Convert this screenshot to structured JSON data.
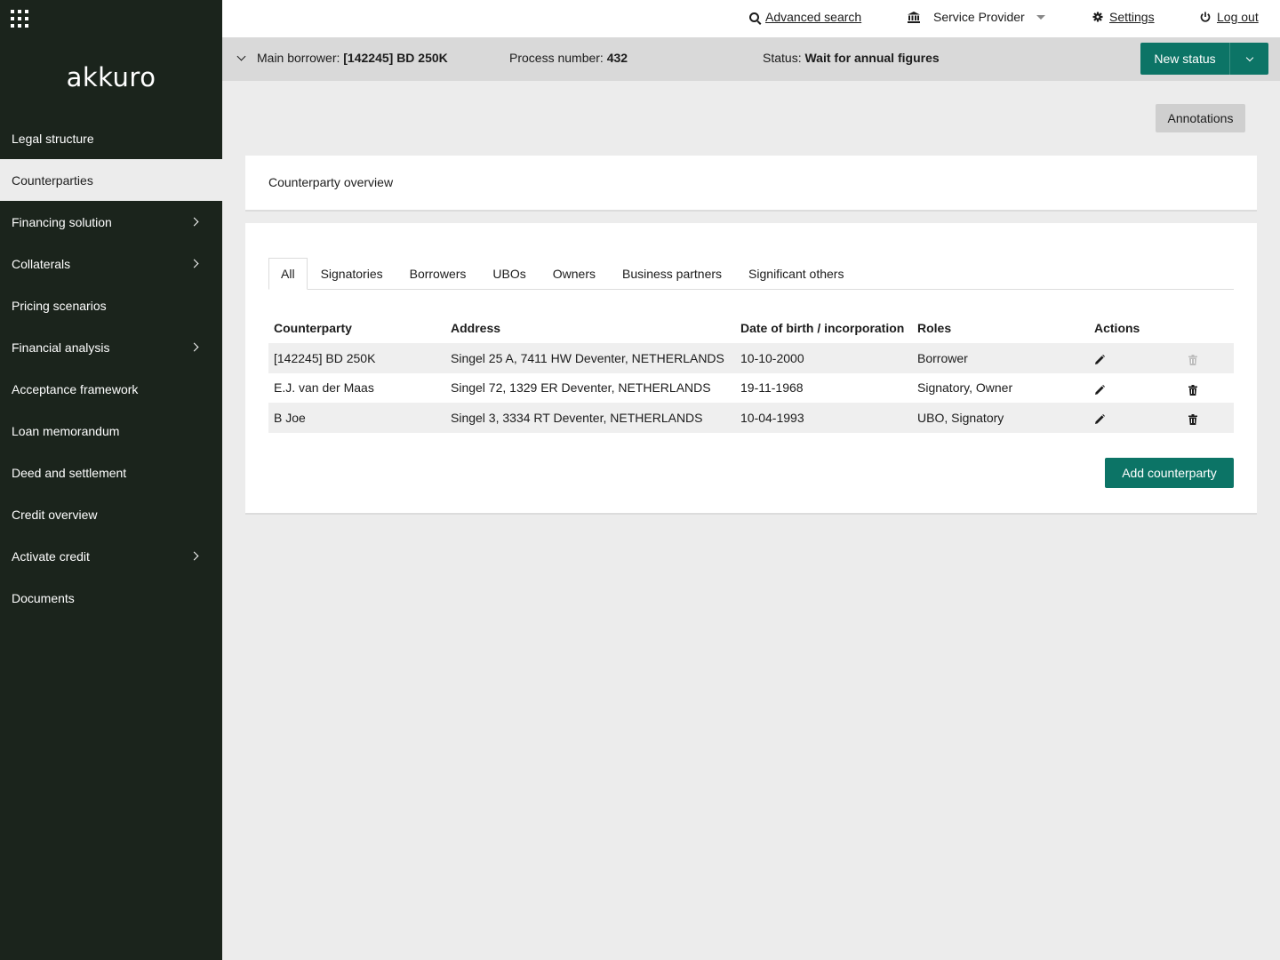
{
  "sidebar": {
    "logo": "akkuro",
    "items": [
      {
        "label": "Legal structure",
        "expandable": false,
        "active": false
      },
      {
        "label": "Counterparties",
        "expandable": false,
        "active": true
      },
      {
        "label": "Financing solution",
        "expandable": true,
        "active": false
      },
      {
        "label": "Collaterals",
        "expandable": true,
        "active": false
      },
      {
        "label": "Pricing scenarios",
        "expandable": false,
        "active": false
      },
      {
        "label": "Financial analysis",
        "expandable": true,
        "active": false
      },
      {
        "label": "Acceptance framework",
        "expandable": false,
        "active": false
      },
      {
        "label": "Loan memorandum",
        "expandable": false,
        "active": false
      },
      {
        "label": "Deed and settlement",
        "expandable": false,
        "active": false
      },
      {
        "label": "Credit overview",
        "expandable": false,
        "active": false
      },
      {
        "label": "Activate credit",
        "expandable": true,
        "active": false
      },
      {
        "label": "Documents",
        "expandable": false,
        "active": false
      }
    ]
  },
  "topbar": {
    "advanced_search": "Advanced search",
    "service_provider": "Service Provider",
    "settings": "Settings",
    "logout": "Log out"
  },
  "processbar": {
    "main_borrower_label": "Main borrower:",
    "main_borrower_value": "[142245] BD 250K",
    "process_number_label": "Process number:",
    "process_number_value": "432",
    "status_label": "Status:",
    "status_value": "Wait for annual figures",
    "new_status_label": "New status"
  },
  "main": {
    "annotations_label": "Annotations",
    "card_title": "Counterparty overview",
    "tabs": [
      {
        "label": "All",
        "active": true
      },
      {
        "label": "Signatories",
        "active": false
      },
      {
        "label": "Borrowers",
        "active": false
      },
      {
        "label": "UBOs",
        "active": false
      },
      {
        "label": "Owners",
        "active": false
      },
      {
        "label": "Business partners",
        "active": false
      },
      {
        "label": "Significant others",
        "active": false
      }
    ],
    "table": {
      "headers": [
        "Counterparty",
        "Address",
        "Date of birth / incorporation",
        "Roles",
        "Actions"
      ],
      "rows": [
        {
          "counterparty": "[142245] BD 250K",
          "address": "Singel 25 A, 7411 HW Deventer, NETHERLANDS",
          "date": "10-10-2000",
          "roles": "Borrower",
          "delete_enabled": false
        },
        {
          "counterparty": "E.J. van der Maas",
          "address": "Singel 72, 1329 ER Deventer, NETHERLANDS",
          "date": "19-11-1968",
          "roles": "Signatory, Owner",
          "delete_enabled": true
        },
        {
          "counterparty": "B Joe",
          "address": "Singel 3, 3334 RT Deventer, NETHERLANDS",
          "date": "10-04-1993",
          "roles": "UBO, Signatory",
          "delete_enabled": true
        }
      ]
    },
    "add_button_label": "Add counterparty"
  },
  "colors": {
    "sidebar_bg": "#1b241c",
    "accent": "#0c7466",
    "page_bg": "#ececec"
  }
}
